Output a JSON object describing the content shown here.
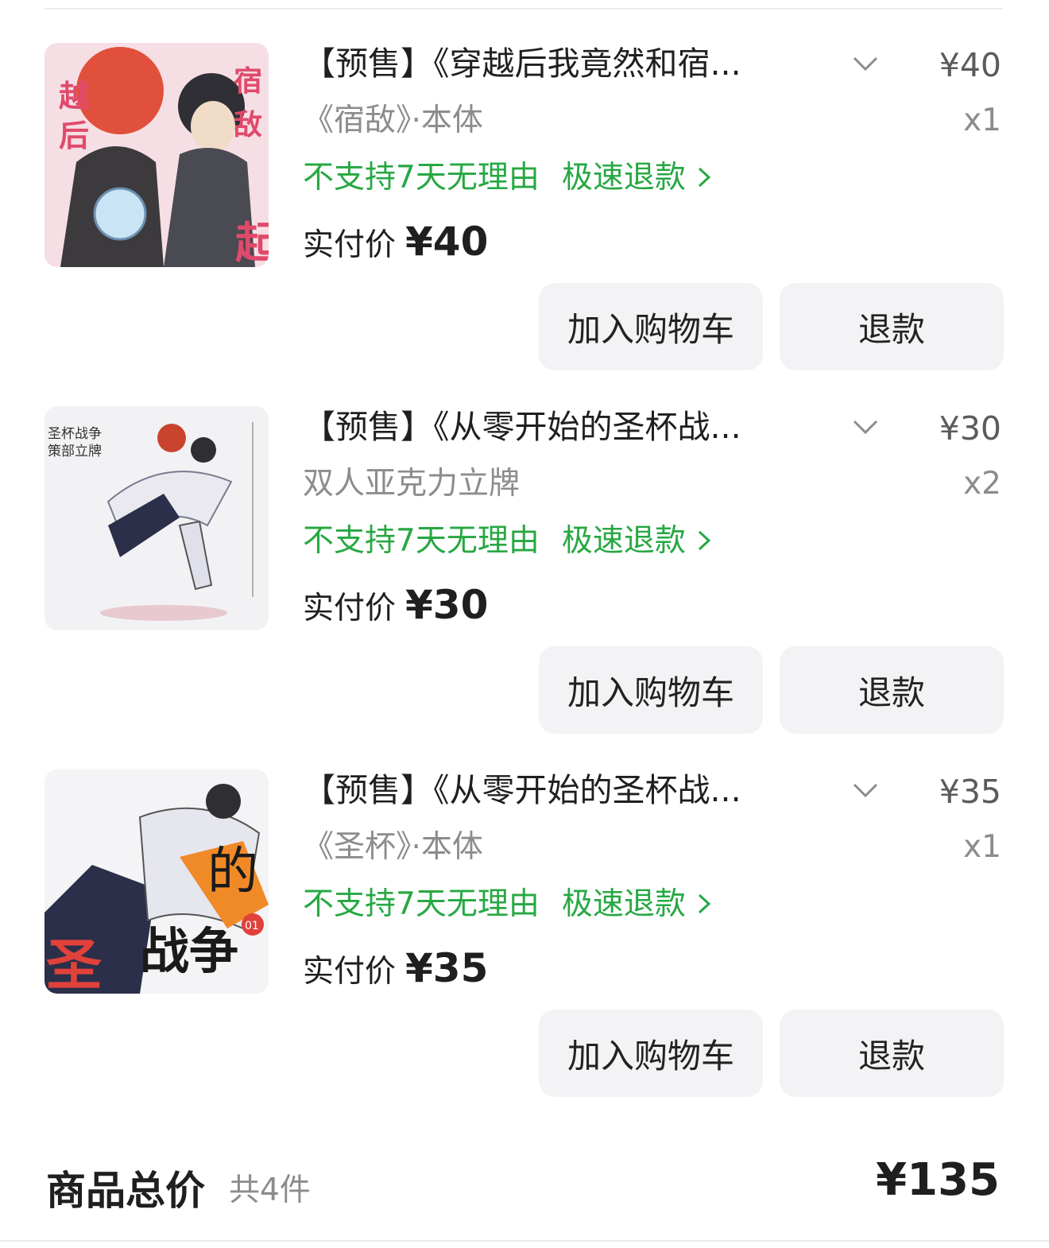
{
  "items": [
    {
      "title": "【预售】《穿越后我竟然和宿...",
      "variant": "《宿敌》·本体",
      "price": "¥40",
      "qty": "x1",
      "policy_no_reason": "不支持7天无理由",
      "policy_fast_refund": "极速退款",
      "paid_label": "实付价",
      "paid_amount": "¥40",
      "btn_cart": "加入购物车",
      "btn_refund": "退款"
    },
    {
      "title": "【预售】《从零开始的圣杯战...",
      "variant": "双人亚克力立牌",
      "price": "¥30",
      "qty": "x2",
      "policy_no_reason": "不支持7天无理由",
      "policy_fast_refund": "极速退款",
      "paid_label": "实付价",
      "paid_amount": "¥30",
      "btn_cart": "加入购物车",
      "btn_refund": "退款"
    },
    {
      "title": "【预售】《从零开始的圣杯战...",
      "variant": "《圣杯》·本体",
      "price": "¥35",
      "qty": "x1",
      "policy_no_reason": "不支持7天无理由",
      "policy_fast_refund": "极速退款",
      "paid_label": "实付价",
      "paid_amount": "¥35",
      "btn_cart": "加入购物车",
      "btn_refund": "退款"
    }
  ],
  "footer": {
    "label": "商品总价",
    "count": "共4件",
    "total": "¥135"
  },
  "colors": {
    "green": "#27a843",
    "button_bg": "#f3f3f5",
    "muted": "#8c8c8c"
  }
}
